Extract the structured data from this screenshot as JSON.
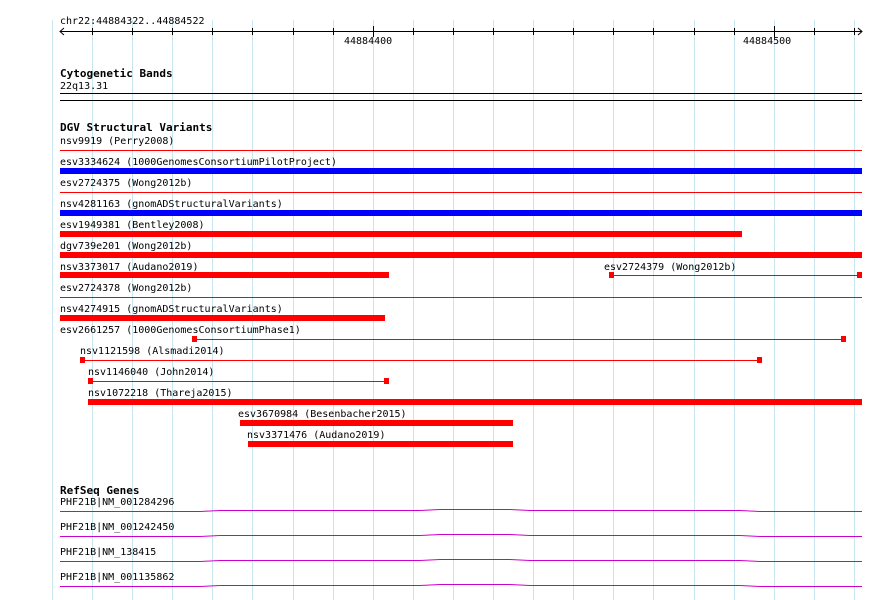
{
  "ruler": {
    "location": "chr22:44884322..44884522",
    "tick_labels": [
      "44884400",
      "44884500"
    ]
  },
  "cytoband": {
    "title": "Cytogenetic Bands",
    "band": "22q13.31"
  },
  "dgv": {
    "title": "DGV Structural Variants",
    "variants": [
      {
        "label": "nsv9919 (Perry2008)",
        "kind": "line",
        "color": "#ff0000",
        "bar_start": 44884322,
        "bar_end": 44884522
      },
      {
        "label": "esv3334624 (1000GenomesConsortiumPilotProject)",
        "kind": "bar",
        "color": "#0000ff",
        "bar_start": 44884322,
        "bar_end": 44884522
      },
      {
        "label": "esv2724375 (Wong2012b)",
        "kind": "line",
        "color": "#ff0000",
        "bar_start": 44884322,
        "bar_end": 44884522
      },
      {
        "label": "nsv4281163 (gnomADStructuralVariants)",
        "kind": "bar",
        "color": "#0000ff",
        "bar_start": 44884322,
        "bar_end": 44884522
      },
      {
        "label": "esv1949381 (Bentley2008)",
        "kind": "bar",
        "color": "#ff0000",
        "bar_start": 44884322,
        "bar_end": 44884492
      },
      {
        "label": "dgv739e201 (Wong2012b)",
        "kind": "bar",
        "color": "#ff0000",
        "bar_start": 44884322,
        "bar_end": 44884522
      },
      {
        "label": "esv2724378 (Wong2012b)",
        "kind": "line",
        "color": "#ff0000",
        "bar_start": 44884322,
        "bar_end": 44884522
      },
      {
        "label": "nsv4274915 (gnomADStructuralVariants)",
        "kind": "bar",
        "color": "#ff0000",
        "bar_start": 44884322,
        "bar_end": 44884403
      },
      {
        "label": "esv2661257 (1000GenomesConsortiumPhase1)",
        "kind": "gapped",
        "color": "#ff0000",
        "bar_start": 44884355,
        "bar_end": 44884518
      },
      {
        "label": "nsv1121598 (Alsmadi2014)",
        "kind": "gapped",
        "color": "#ff0000",
        "bar_start": 44884327,
        "bar_end": 44884497
      },
      {
        "label": "nsv1146040 (John2014)",
        "kind": "gapped",
        "color": "#ff0000",
        "bar_start": 44884329,
        "bar_end": 44884404
      },
      {
        "label": "nsv1072218 (Thareja2015)",
        "kind": "bar",
        "color": "#ff0000",
        "bar_start": 44884329,
        "bar_end": 44884522
      },
      {
        "label": "esv3670984 (Besenbacher2015)",
        "kind": "bar",
        "color": "#ff0000",
        "bar_start": 44884367,
        "bar_end": 44884435
      },
      {
        "label": "nsv3371476 (Audano2019)",
        "kind": "bar",
        "color": "#ff0000",
        "bar_start": 44884369,
        "bar_end": 44884435
      }
    ],
    "split_row": {
      "left": {
        "label": "nsv3373017 (Audano2019)",
        "kind": "bar",
        "color": "#ff0000",
        "bar_start": 44884322,
        "bar_end": 44884404
      },
      "right": {
        "label": "esv2724379 (Wong2012b)",
        "kind": "gapped",
        "color": "#ff0000",
        "bar_start": 44884459,
        "bar_end": 44884522
      }
    }
  },
  "refseq": {
    "title": "RefSeq Genes",
    "genes": [
      {
        "label": "PHF21B|NM_001284296",
        "color": "#cc00cc"
      },
      {
        "label": "PHF21B|NM_001242450",
        "color": "#cc00cc"
      },
      {
        "label": "PHF21B|NM_138415",
        "color": "#cc00cc"
      },
      {
        "label": "PHF21B|NM_001135862",
        "color": "#cc00cc"
      }
    ]
  },
  "colors": {
    "grid": "#c8e6f0",
    "variant_red": "#ff0000",
    "variant_blue": "#0000ff",
    "gene_magenta": "#cc00cc"
  }
}
